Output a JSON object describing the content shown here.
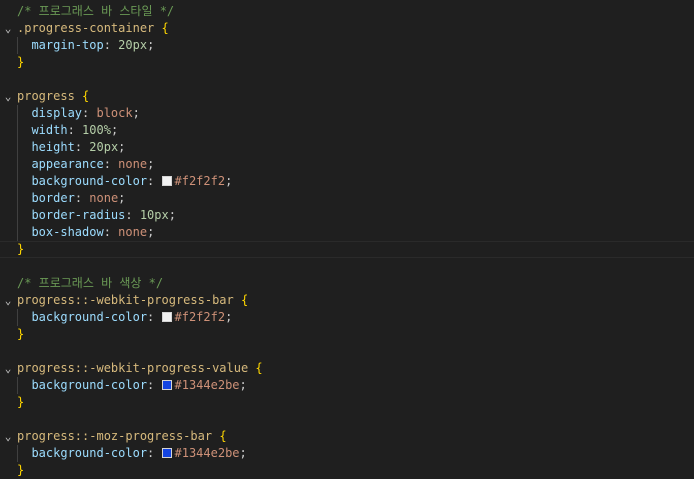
{
  "code_lines": [
    {
      "text": "/* 프로그래스 바 스타일 */",
      "kind": "comment",
      "fold": false
    },
    {
      "text": ".progress-container {",
      "kind": "selector",
      "selector": ".progress-container",
      "fold": true
    },
    {
      "prop": "margin-top",
      "value": "20px",
      "value_kind": "num",
      "indent": true
    },
    {
      "text": "}",
      "kind": "close"
    },
    {
      "text": "",
      "kind": "blank"
    },
    {
      "text": "progress {",
      "kind": "selector",
      "selector": "progress",
      "fold": true
    },
    {
      "prop": "display",
      "value": "block",
      "value_kind": "val",
      "indent": true
    },
    {
      "prop": "width",
      "value": "100%",
      "value_kind": "num",
      "indent": true
    },
    {
      "prop": "height",
      "value": "20px",
      "value_kind": "num",
      "indent": true
    },
    {
      "prop": "appearance",
      "value": "none",
      "value_kind": "val",
      "indent": true
    },
    {
      "prop": "background-color",
      "value": "#f2f2f2",
      "value_kind": "color",
      "swatch": "#f2f2f2",
      "indent": true
    },
    {
      "prop": "border",
      "value": "none",
      "value_kind": "val",
      "indent": true
    },
    {
      "prop": "border-radius",
      "value": "10px",
      "value_kind": "num",
      "indent": true
    },
    {
      "prop": "box-shadow",
      "value": "none",
      "value_kind": "val",
      "indent": true
    },
    {
      "text": "}",
      "kind": "close",
      "current": true
    },
    {
      "text": "",
      "kind": "blank"
    },
    {
      "text": "/* 프로그래스 바 색상 */",
      "kind": "comment"
    },
    {
      "text": "progress::-webkit-progress-bar {",
      "kind": "selector",
      "selector": "progress::-webkit-progress-bar",
      "fold": true
    },
    {
      "prop": "background-color",
      "value": "#f2f2f2",
      "value_kind": "color",
      "swatch": "#f2f2f2",
      "indent": true
    },
    {
      "text": "}",
      "kind": "close"
    },
    {
      "text": "",
      "kind": "blank"
    },
    {
      "text": "progress::-webkit-progress-value {",
      "kind": "selector",
      "selector": "progress::-webkit-progress-value",
      "fold": true
    },
    {
      "prop": "background-color",
      "value": "#1344e2be",
      "value_kind": "color",
      "swatch": "#1344e2",
      "indent": true
    },
    {
      "text": "}",
      "kind": "close"
    },
    {
      "text": "",
      "kind": "blank"
    },
    {
      "text": "progress::-moz-progress-bar {",
      "kind": "selector",
      "selector": "progress::-moz-progress-bar",
      "fold": true
    },
    {
      "prop": "background-color",
      "value": "#1344e2be",
      "value_kind": "color",
      "swatch": "#1344e2",
      "indent": true
    },
    {
      "text": "}",
      "kind": "close"
    }
  ],
  "colors": {
    "editor_bg": "#1f1f1f",
    "comment": "#6a9955",
    "selector": "#d7ba7d",
    "brace": "#ffd700",
    "property": "#9cdcfe",
    "number": "#b5cea8",
    "string_value": "#ce9178"
  },
  "icons": {
    "fold": "chevron-down-icon"
  }
}
